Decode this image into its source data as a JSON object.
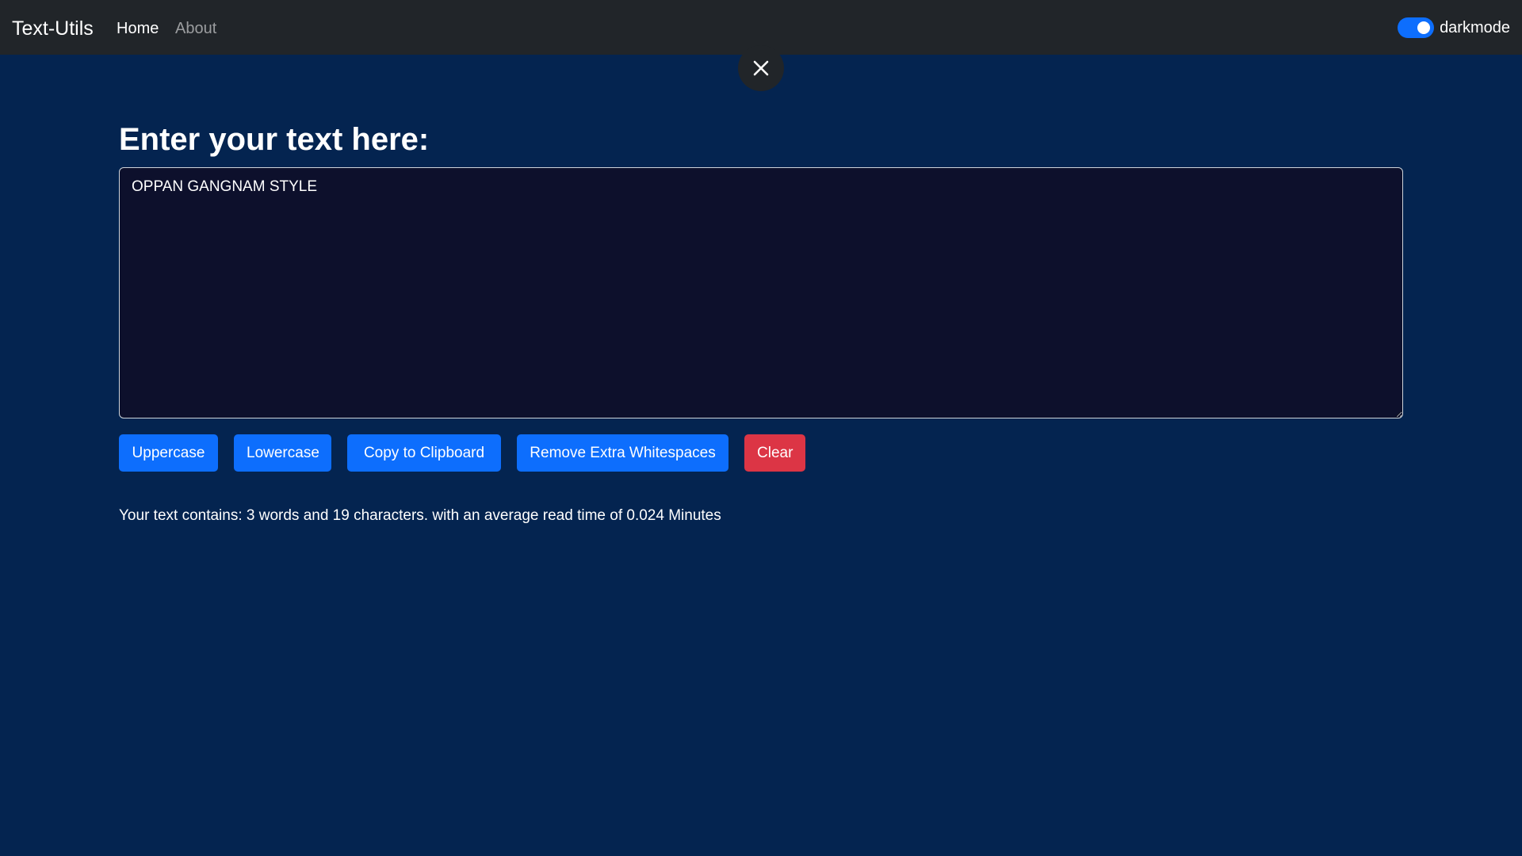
{
  "navbar": {
    "brand": "Text-Utils",
    "links": [
      {
        "label": "Home"
      },
      {
        "label": "About"
      }
    ],
    "darkmode_label": "darkmode"
  },
  "main": {
    "heading": "Enter your text here:",
    "textarea_value": "OPPAN GANGNAM STYLE",
    "buttons": {
      "uppercase": "Uppercase",
      "lowercase": "Lowercase",
      "copy": "Copy to Clipboard",
      "remove_ws": "Remove Extra Whitespaces",
      "clear": "Clear"
    },
    "summary": "Your text contains: 3 words and 19 characters. with an average read time of 0.024 Minutes"
  },
  "colors": {
    "background": "#042450",
    "navbar": "#212529",
    "primary": "#0d6efd",
    "danger": "#dc3545",
    "textarea_bg": "#0d102c"
  },
  "icons": {
    "close": "close-icon"
  }
}
